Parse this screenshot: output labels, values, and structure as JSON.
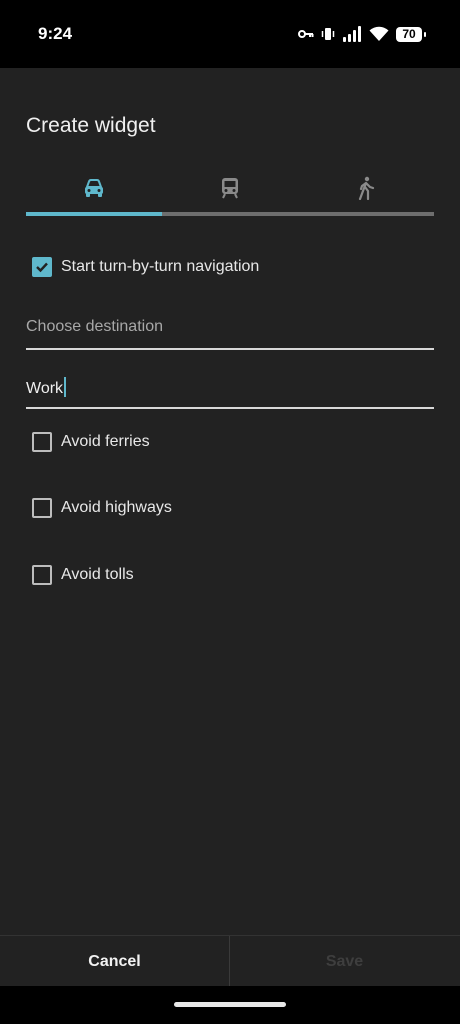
{
  "status_bar": {
    "time": "9:24",
    "battery": "70"
  },
  "dialog": {
    "title": "Create widget",
    "tabs": [
      {
        "icon": "car-icon",
        "selected": true
      },
      {
        "icon": "train-icon",
        "selected": false
      },
      {
        "icon": "walk-icon",
        "selected": false
      }
    ],
    "start_navigation": {
      "label": "Start turn-by-turn navigation",
      "checked": true
    },
    "destination": {
      "placeholder": "Choose destination",
      "value": "Work"
    },
    "options": [
      {
        "label": "Avoid ferries",
        "checked": false
      },
      {
        "label": "Avoid highways",
        "checked": false
      },
      {
        "label": "Avoid tolls",
        "checked": false
      }
    ],
    "buttons": {
      "cancel": "Cancel",
      "save": "Save"
    }
  },
  "colors": {
    "accent": "#5fb8cc",
    "background": "#222222"
  }
}
